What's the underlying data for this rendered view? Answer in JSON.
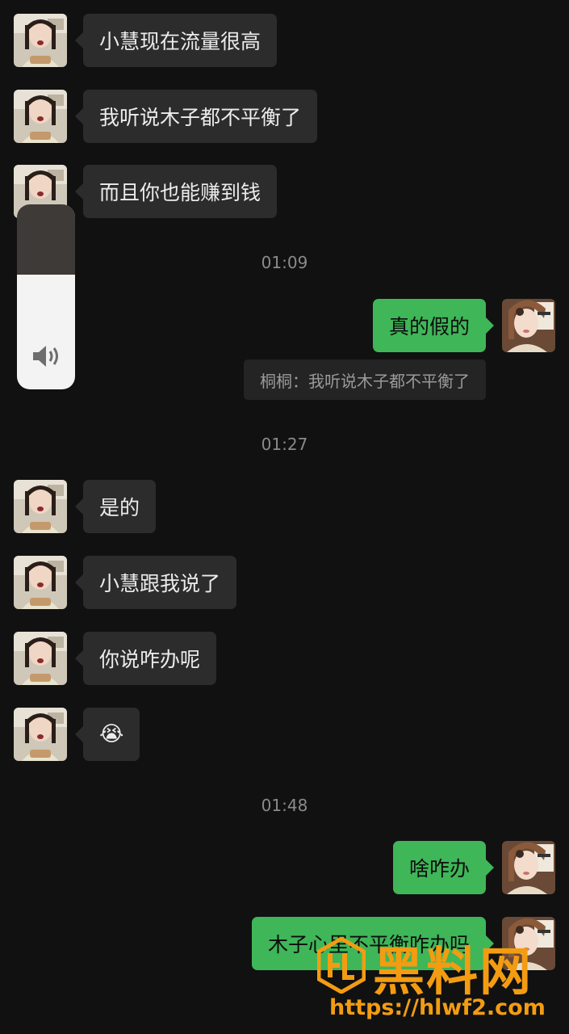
{
  "messages": [
    {
      "side": "in",
      "text": "小慧现在流量很高"
    },
    {
      "side": "in",
      "text": "我听说木子都不平衡了"
    },
    {
      "side": "in",
      "text": "而且你也能赚到钱"
    },
    {
      "side": "time",
      "text": "01:09"
    },
    {
      "side": "out",
      "text": "真的假的"
    },
    {
      "side": "quote",
      "text": "桐桐：我听说木子都不平衡了"
    },
    {
      "side": "time",
      "text": "01:27"
    },
    {
      "side": "in",
      "text": "是的"
    },
    {
      "side": "in",
      "text": "小慧跟我说了"
    },
    {
      "side": "in",
      "text": "你说咋办呢"
    },
    {
      "side": "in",
      "text": "😭"
    },
    {
      "side": "time",
      "text": "01:48"
    },
    {
      "side": "out",
      "text": "啥咋办"
    },
    {
      "side": "out",
      "text": "木子心里不平衡咋办吗"
    }
  ],
  "volume": {
    "level": 0.62,
    "icon": "speaker-icon"
  },
  "watermark": {
    "brand": "黑料网",
    "url": "https://hlwf2.com",
    "color": "#f39c12"
  },
  "colors": {
    "background": "#111111",
    "incoming_bubble": "#2c2c2c",
    "outgoing_bubble": "#3fb658"
  }
}
